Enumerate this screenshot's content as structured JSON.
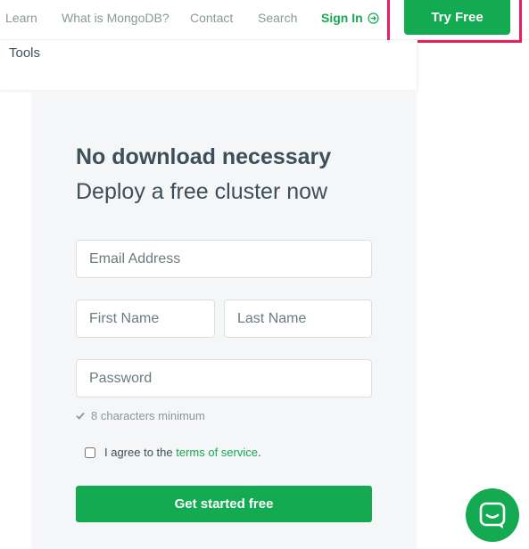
{
  "colors": {
    "brand_green": "#13aa52",
    "highlight_border": "#e91e5b",
    "panel_bg": "#f5f6f7",
    "text_dark": "#3d4f58",
    "text_muted": "#89989b"
  },
  "nav": {
    "links": [
      "Learn",
      "What is MongoDB?",
      "Contact",
      "Search"
    ],
    "sign_in": "Sign In",
    "sign_in_icon": "sign-in-arrow-icon",
    "try_free": "Try Free"
  },
  "tools": {
    "label": "Tools"
  },
  "form": {
    "headline": "No download necessary",
    "subhead": "Deploy a free cluster now",
    "email_placeholder": "Email Address",
    "first_name_placeholder": "First Name",
    "last_name_placeholder": "Last Name",
    "password_placeholder": "Password",
    "password_hint": "8 characters minimum",
    "hint_icon": "checkmark-icon",
    "agree_prefix": "I agree to the ",
    "terms_link": "terms of service",
    "agree_suffix": ".",
    "submit_label": "Get started free"
  },
  "chat": {
    "icon": "chat-bubble-icon"
  }
}
